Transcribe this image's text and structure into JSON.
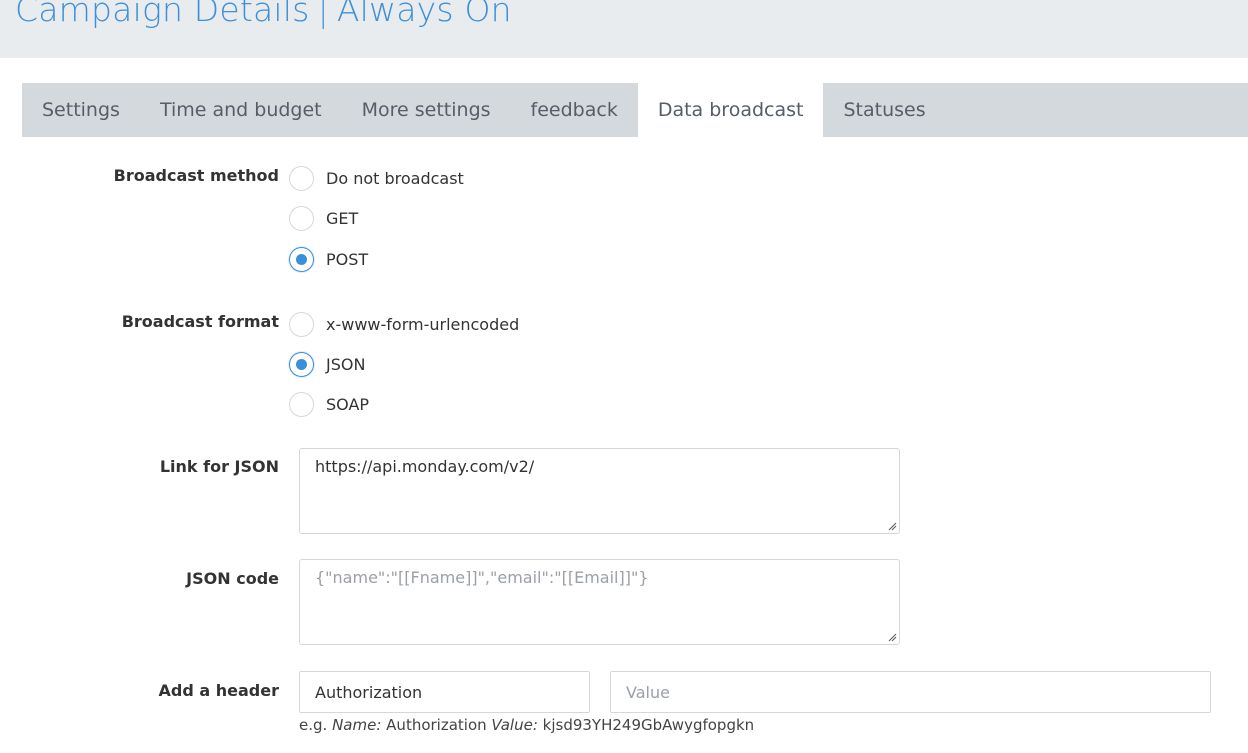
{
  "header": {
    "title": "Campaign Details",
    "separator": "|",
    "subtitle": "Always On"
  },
  "tabs": [
    {
      "label": "Settings",
      "active": false
    },
    {
      "label": "Time and budget",
      "active": false
    },
    {
      "label": "More settings",
      "active": false
    },
    {
      "label": "feedback",
      "active": false
    },
    {
      "label": "Data broadcast",
      "active": true
    },
    {
      "label": "Statuses",
      "active": false
    }
  ],
  "broadcast_method": {
    "label": "Broadcast method",
    "options": [
      {
        "label": "Do not broadcast",
        "checked": false
      },
      {
        "label": "GET",
        "checked": false
      },
      {
        "label": "POST",
        "checked": true
      }
    ]
  },
  "broadcast_format": {
    "label": "Broadcast format",
    "options": [
      {
        "label": "x-www-form-urlencoded",
        "checked": false
      },
      {
        "label": "JSON",
        "checked": true
      },
      {
        "label": "SOAP",
        "checked": false
      }
    ]
  },
  "link_for_json": {
    "label": "Link for JSON",
    "value": "https://api.monday.com/v2/"
  },
  "json_code": {
    "label": "JSON code",
    "placeholder": "{\"name\":\"[[Fname]]\",\"email\":\"[[Email]]\"}"
  },
  "add_header": {
    "label": "Add a header",
    "name_value": "Authorization",
    "value_placeholder": "Value",
    "hint_prefix": "e.g.",
    "hint_name_label": "Name:",
    "hint_name_value": "Authorization",
    "hint_value_label": "Value:",
    "hint_value_value": "kjsd93YH249GbAwygfopgkn"
  },
  "colors": {
    "accent": "#3b8fd9",
    "title": "#3e8fd5",
    "header_bg": "#e9ecef",
    "tabbar_bg": "#d4d9de"
  }
}
